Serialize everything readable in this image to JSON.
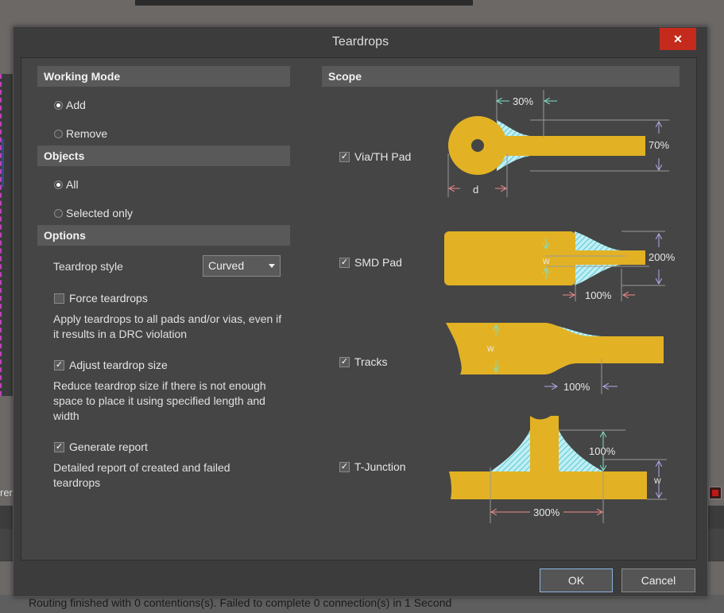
{
  "dialog": {
    "title": "Teardrops",
    "close_label": "✕",
    "ok_label": "OK",
    "cancel_label": "Cancel"
  },
  "working_mode": {
    "header": "Working Mode",
    "options": [
      {
        "label": "Add",
        "selected": true
      },
      {
        "label": "Remove",
        "selected": false
      }
    ]
  },
  "objects": {
    "header": "Objects",
    "options": [
      {
        "label": "All",
        "selected": true
      },
      {
        "label": "Selected only",
        "selected": false
      }
    ]
  },
  "options": {
    "header": "Options",
    "style_label": "Teardrop style",
    "style_value": "Curved",
    "force": {
      "label": "Force teardrops",
      "checked": false,
      "desc": "Apply teardrops to all pads and/or vias, even if it results in a DRC violation"
    },
    "adjust": {
      "label": "Adjust teardrop size",
      "checked": true,
      "desc": "Reduce teardrop size if there is not enough space to place it using specified length and width"
    },
    "report": {
      "label": "Generate report",
      "checked": true,
      "desc": "Detailed report of created and failed teardrops"
    }
  },
  "scope": {
    "header": "Scope",
    "items": [
      {
        "label": "Via/TH Pad",
        "checked": true
      },
      {
        "label": "SMD Pad",
        "checked": true
      },
      {
        "label": "Tracks",
        "checked": true
      },
      {
        "label": "T-Junction",
        "checked": true
      }
    ],
    "diagram_labels": {
      "via_len": "30%",
      "via_width": "70%",
      "via_d": "d",
      "smd_w": "w",
      "smd_width": "200%",
      "smd_len": "100%",
      "track_w": "w",
      "track_len": "100%",
      "tj_height": "100%",
      "tj_w": "w",
      "tj_len": "300%"
    }
  },
  "background": {
    "status_text": "Routing finished  with 0 contentions(s). Failed to complete 0 connection(s) in 1 Second",
    "left_fragment": "rer"
  },
  "colors": {
    "copper": "#e2b224",
    "hatch": "#8fe0ea",
    "accent_close": "#c42b1c"
  }
}
